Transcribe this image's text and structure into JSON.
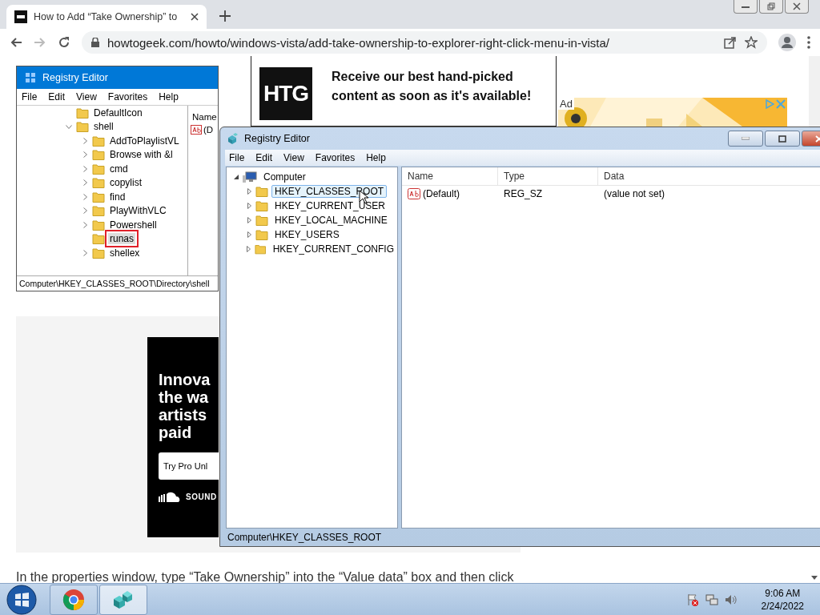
{
  "browser": {
    "tab": {
      "title": "How to Add “Take Ownership” to"
    },
    "url": "howtogeek.com/howto/windows-vista/add-take-ownership-to-explorer-right-click-menu-in-vista/",
    "back_disabled": false,
    "forward_disabled": true
  },
  "article_image": {
    "title": "Registry Editor",
    "menu": [
      "File",
      "Edit",
      "View",
      "Favorites",
      "Help"
    ],
    "tree": [
      {
        "label": "DefaultIcon",
        "kind": "leaf",
        "selected": false
      },
      {
        "label": "shell",
        "kind": "open",
        "selected": false
      },
      {
        "label": "AddToPlaylistVL",
        "kind": "closed",
        "selected": false
      },
      {
        "label": "Browse with &l",
        "kind": "closed",
        "selected": false
      },
      {
        "label": "cmd",
        "kind": "closed",
        "selected": false
      },
      {
        "label": "copylist",
        "kind": "closed",
        "selected": false
      },
      {
        "label": "find",
        "kind": "closed",
        "selected": false
      },
      {
        "label": "PlayWithVLC",
        "kind": "closed",
        "selected": false
      },
      {
        "label": "Powershell",
        "kind": "closed",
        "selected": false
      },
      {
        "label": "runas",
        "kind": "leaf",
        "selected": true
      },
      {
        "label": "shellex",
        "kind": "closed",
        "selected": false
      }
    ],
    "column": "Name",
    "value": "(D",
    "status": "Computer\\HKEY_CLASSES_ROOT\\Directory\\shell"
  },
  "popup": {
    "logo": "HTG",
    "message": "Receive our best hand-picked content as soon as it's available!"
  },
  "banner_ad": {
    "label": "Ad",
    "kind": "picture"
  },
  "side_ad": {
    "headline": [
      "Innova",
      "the wa",
      "artists",
      "paid"
    ],
    "button": "Try Pro Unl",
    "brand": "SOUND"
  },
  "paragraph": "In the properties window, type “Take Ownership” into the “Value data” box and then click",
  "regedit": {
    "title": "Registry Editor",
    "menu": [
      "File",
      "Edit",
      "View",
      "Favorites",
      "Help"
    ],
    "root": "Computer",
    "keys": [
      {
        "label": "HKEY_CLASSES_ROOT",
        "selected": true
      },
      {
        "label": "HKEY_CURRENT_USER",
        "selected": false
      },
      {
        "label": "HKEY_LOCAL_MACHINE",
        "selected": false
      },
      {
        "label": "HKEY_USERS",
        "selected": false
      },
      {
        "label": "HKEY_CURRENT_CONFIG",
        "selected": false
      }
    ],
    "columns": [
      "Name",
      "Type",
      "Data"
    ],
    "rows": [
      {
        "name": "(Default)",
        "type": "REG_SZ",
        "data": "(value not set)"
      }
    ],
    "status": "Computer\\HKEY_CLASSES_ROOT"
  },
  "taskbar": {
    "apps": [
      {
        "kind": "chrome",
        "selected": false
      },
      {
        "kind": "registry",
        "selected": true
      }
    ],
    "time": "9:06 AM",
    "date": "2/24/2022"
  }
}
